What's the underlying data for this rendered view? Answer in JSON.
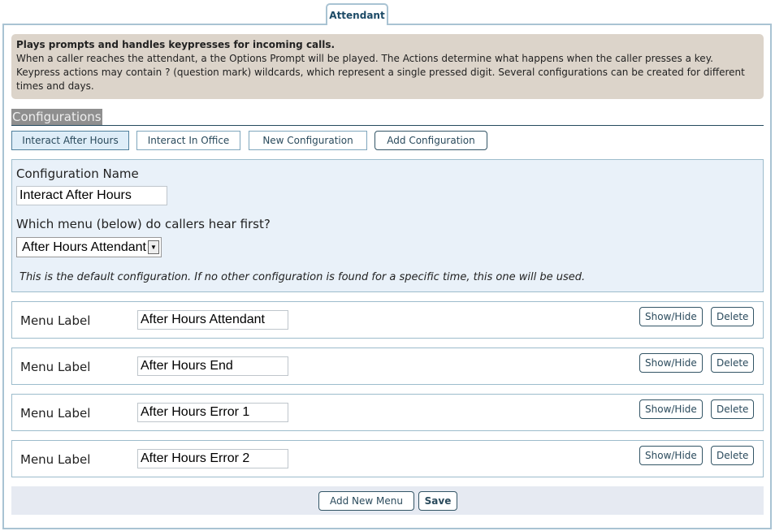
{
  "tab": {
    "label": "Attendant"
  },
  "info": {
    "title": "Plays prompts and handles keypresses for incoming calls.",
    "body": "When a caller reaches the attendant, a the Options Prompt will be played. The Actions determine what happens when the caller presses a key. Keypress actions may contain ? (question mark) wildcards, which represent a single pressed digit. Several configurations can be created for different times and days."
  },
  "configurations": {
    "heading": "Configurations",
    "tabs": [
      "Interact After Hours",
      "Interact In Office",
      "New Configuration"
    ],
    "add_label": "Add Configuration"
  },
  "config": {
    "name_label": "Configuration Name",
    "name_value": "Interact After Hours",
    "menu_label": "Which menu (below) do callers hear first?",
    "menu_value": "After Hours Attendant",
    "note": "This is the default configuration. If no other configuration is found for a specific time, this one will be used."
  },
  "menus": [
    {
      "label": "Menu Label",
      "value": "After Hours Attendant",
      "show_hide": "Show/Hide",
      "delete": "Delete"
    },
    {
      "label": "Menu Label",
      "value": "After Hours End",
      "show_hide": "Show/Hide",
      "delete": "Delete"
    },
    {
      "label": "Menu Label",
      "value": "After Hours Error 1",
      "show_hide": "Show/Hide",
      "delete": "Delete"
    },
    {
      "label": "Menu Label",
      "value": "After Hours Error 2",
      "show_hide": "Show/Hide",
      "delete": "Delete"
    }
  ],
  "footer": {
    "add_menu": "Add New Menu",
    "save": "Save"
  }
}
